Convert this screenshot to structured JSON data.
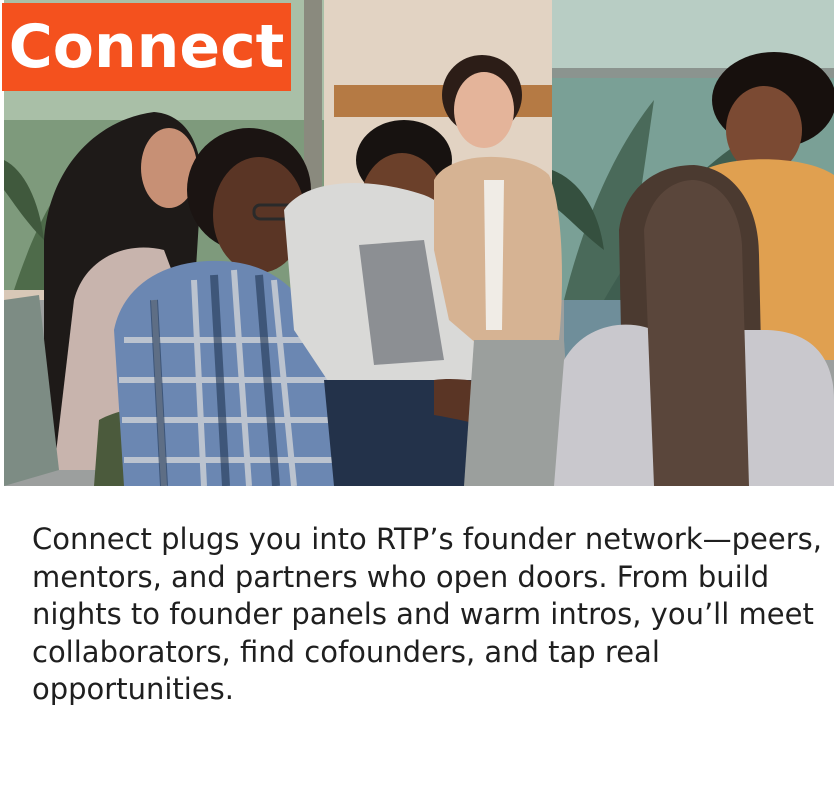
{
  "card": {
    "title": "Connect",
    "description": "Connect plugs you into RTP’s founder network—peers, mentors, and partners who open doors. From build nights to founder panels and warm intros, you’ll meet collaborators, find cofounders, and tap real opportunities."
  },
  "colors": {
    "badge_background": "#f4511e",
    "badge_text": "#ffffff",
    "body_text": "#1f1f1f",
    "page_background": "#ffffff"
  },
  "photo": {
    "subject": "group of young people sitting in a circle talking"
  }
}
